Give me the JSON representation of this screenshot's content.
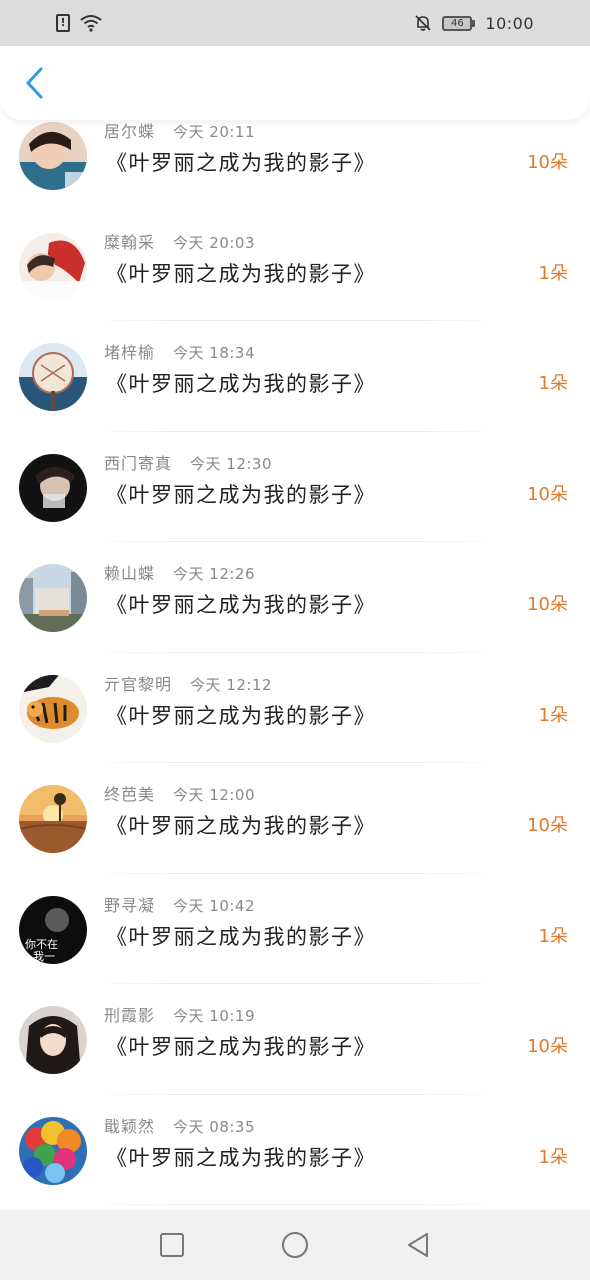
{
  "status_bar": {
    "sim_label": "!",
    "battery_level": "46",
    "time": "10:00"
  },
  "header": {
    "back_icon": "chevron-left-icon"
  },
  "list": [
    {
      "name": "居尔蝶",
      "time": "今天 20:11",
      "title": "《叶罗丽之成为我的影子》",
      "count": "10朵",
      "avatar": "portrait-boy"
    },
    {
      "name": "糜翰采",
      "time": "今天 20:03",
      "title": "《叶罗丽之成为我的影子》",
      "count": "1朵",
      "avatar": "child-red-hat"
    },
    {
      "name": "堵梓榆",
      "time": "今天 18:34",
      "title": "《叶罗丽之成为我的影子》",
      "count": "1朵",
      "avatar": "fan-blue"
    },
    {
      "name": "西门寄真",
      "time": "今天 12:30",
      "title": "《叶罗丽之成为我的影子》",
      "count": "10朵",
      "avatar": "portrait-dark"
    },
    {
      "name": "赖山蝶",
      "time": "今天 12:26",
      "title": "《叶罗丽之成为我的影子》",
      "count": "10朵",
      "avatar": "street-scene"
    },
    {
      "name": "亓官黎明",
      "time": "今天 12:12",
      "title": "《叶罗丽之成为我的影子》",
      "count": "1朵",
      "avatar": "tiger"
    },
    {
      "name": "终芭美",
      "time": "今天 12:00",
      "title": "《叶罗丽之成为我的影子》",
      "count": "10朵",
      "avatar": "desert-sunset"
    },
    {
      "name": "野寻凝",
      "time": "今天 10:42",
      "title": "《叶罗丽之成为我的影子》",
      "count": "1朵",
      "avatar": "dark-text",
      "avatar_text": "你不在\n我一"
    },
    {
      "name": "刑霞影",
      "time": "今天 10:19",
      "title": "《叶罗丽之成为我的影子》",
      "count": "10朵",
      "avatar": "portrait-girl"
    },
    {
      "name": "戢颖然",
      "time": "今天 08:35",
      "title": "《叶罗丽之成为我的影子》",
      "count": "1朵",
      "avatar": "balloons"
    }
  ],
  "colors": {
    "accent_blue": "#2f9be0",
    "count_orange": "#e07a2b"
  },
  "nav_bar": {
    "icons": [
      "square-icon",
      "circle-icon",
      "triangle-back-icon"
    ]
  }
}
